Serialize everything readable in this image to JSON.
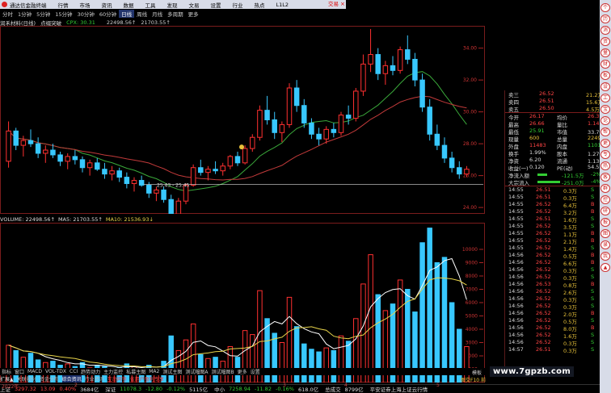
{
  "titlebar": {
    "app_name": "通达信金融终端",
    "menus": [
      "行情",
      "市场",
      "资讯",
      "数据",
      "工具",
      "发现",
      "文易",
      "设置",
      "行业",
      "热点",
      "L1L2"
    ],
    "trade_label": "交易",
    "close_label": "×"
  },
  "periods": [
    "分时",
    "1分钟",
    "5分钟",
    "15分钟",
    "30分钟",
    "60分钟",
    "日线",
    "周线",
    "月线",
    "多周期",
    "更多"
  ],
  "active_period": 6,
  "info": {
    "stock": "润禾材料(日线)",
    "pattern": "点缀突破",
    "cpx": "CPX: 30.31",
    "v1": "22498.56↑",
    "v2": "21703.55↑"
  },
  "price_axis": {
    "ticks": [
      "34.00",
      "32.00",
      "30.00",
      "28.00",
      "26.00",
      "24.00"
    ]
  },
  "annotations": {
    "range": "25.43 - 25.45",
    "low": "22.99"
  },
  "volume": {
    "label": "VOLUME: 22498.56↑",
    "ma5": "MA5: 21703.55↑",
    "ma10": "MA10: 21536.93↓",
    "ticks": [
      "10000",
      "9000",
      "8000",
      "7000",
      "6000",
      "5000",
      "4000",
      "3000",
      "2000",
      "1000"
    ]
  },
  "xaxis": {
    "year": "2022年",
    "months": [
      "2",
      "3",
      "4",
      "5"
    ]
  },
  "quote": {
    "asks": [
      [
        "卖三",
        "26.52",
        "21.2万"
      ],
      [
        "卖四",
        "26.51",
        "15.6万"
      ],
      [
        "卖五",
        "26.50",
        "4.5万"
      ]
    ],
    "stats": [
      [
        "今开",
        "26.17",
        "均价",
        "26.36"
      ],
      [
        "最高",
        "26.66",
        "量比",
        "1.14"
      ],
      [
        "最低",
        "25.91",
        "市值",
        "33.7亿"
      ],
      [
        "现量",
        "600",
        "总量",
        "22499"
      ],
      [
        "外盘",
        "11483",
        "内盘",
        "11016"
      ],
      [
        "换手",
        "1.99%",
        "股本",
        "1.27亿"
      ],
      [
        "净资",
        "6.20",
        "流通",
        "1.13亿"
      ],
      [
        "收益(一)",
        "0.120",
        "PE(动)",
        "54.5"
      ]
    ],
    "flows": [
      [
        "净流入额",
        "-121.5万",
        "-2%"
      ],
      [
        "大宗流入",
        "-251.0万",
        "-4%"
      ]
    ],
    "ticks": [
      [
        "14:55",
        "26.51",
        "0.3万",
        "S"
      ],
      [
        "14:55",
        "26.51",
        "0.3万",
        "S"
      ],
      [
        "14:55",
        "26.52",
        "6.4万",
        "B"
      ],
      [
        "14:55",
        "26.52",
        "3.2万",
        "B"
      ],
      [
        "14:55",
        "26.51",
        "1.6万",
        "S"
      ],
      [
        "14:55",
        "26.52",
        "3.5万",
        "S"
      ],
      [
        "14:55",
        "26.52",
        "1.1万",
        "B"
      ],
      [
        "14:55",
        "26.52",
        "2.1万",
        "B"
      ],
      [
        "14:55",
        "26.52",
        "1.4万",
        "S"
      ],
      [
        "14:56",
        "26.52",
        "0.5万",
        "B"
      ],
      [
        "14:56",
        "26.52",
        "6.6万",
        "B"
      ],
      [
        "14:56",
        "26.52",
        "0.3万",
        "S"
      ],
      [
        "14:56",
        "26.52",
        "0.3万",
        "S"
      ],
      [
        "14:56",
        "26.53",
        "0.8万",
        "B"
      ],
      [
        "14:56",
        "26.52",
        "2.6万",
        "S"
      ],
      [
        "14:56",
        "26.52",
        "0.3万",
        "S"
      ],
      [
        "14:56",
        "26.52",
        "0.3万",
        "S"
      ],
      [
        "14:56",
        "26.52",
        "2.0万",
        "B"
      ],
      [
        "14:56",
        "26.52",
        "0.5万",
        "S"
      ],
      [
        "14:56",
        "26.52",
        "8.0万",
        "B"
      ],
      [
        "14:56",
        "26.52",
        "1.6万",
        "S"
      ],
      [
        "14:56",
        "26.52",
        "0.3万",
        "S"
      ],
      [
        "14:57",
        "26.51",
        "0.3万",
        "S"
      ]
    ]
  },
  "tabs": [
    "指标",
    "窗口",
    "MACD",
    "VOL-TDX",
    "CCI",
    "趋势动力",
    "主力监控",
    "私募主图",
    "MA2",
    "测试主图",
    "测试幅图A",
    "测试幅图B",
    "更多",
    "设置"
  ],
  "sub_tabs": [
    "扩展▲",
    "关联股份",
    "资金分布",
    "综合资讯",
    "行业资讯",
    "互动问答",
    "雀用户盈利专享"
  ],
  "side_labels": {
    "mode": "模板",
    "right": "图交F10 前"
  },
  "statusbar": {
    "items": [
      [
        "上证",
        "3297.32",
        "13.09",
        "0.40%",
        "3684亿"
      ],
      [
        "深证",
        "11078.3",
        "-12.80",
        "-0.12%",
        "5115亿"
      ],
      [
        "中小",
        "7258.94",
        "-11.82",
        "-0.16%",
        "618.0亿"
      ],
      [
        "总成交",
        "8799亿",
        "",
        " ",
        ""
      ]
    ],
    "ticker": "平安证券上海上证云行情"
  },
  "watermark": "www.7gpzb.com",
  "scroll_icons": [
    "个",
    "历",
    "消",
    "资",
    "量",
    "财",
    "板",
    "设",
    "工",
    "宝",
    "论",
    "帮",
    "更",
    "专",
    "热",
    "客",
    "群",
    "控",
    "研",
    "报",
    "图",
    "录",
    "我",
    "▲"
  ],
  "chart_data": [
    {
      "type": "candlestick",
      "y_axis_ticks": [
        34,
        32,
        30,
        28,
        26,
        24
      ],
      "ylim": [
        23.6,
        35.4
      ],
      "ohlc": [
        [
          26.9,
          29.4,
          26.5,
          28.8
        ],
        [
          28.8,
          29.0,
          27.6,
          27.9
        ],
        [
          27.9,
          28.5,
          27.2,
          28.2
        ],
        [
          28.2,
          28.9,
          27.8,
          28.0
        ],
        [
          28.0,
          28.4,
          27.1,
          27.4
        ],
        [
          27.4,
          27.9,
          26.8,
          27.6
        ],
        [
          27.6,
          28.0,
          27.1,
          27.3
        ],
        [
          27.3,
          27.5,
          26.6,
          26.9
        ],
        [
          26.9,
          27.4,
          26.4,
          27.2
        ],
        [
          27.2,
          27.6,
          26.7,
          27.0
        ],
        [
          27.0,
          27.2,
          26.2,
          26.5
        ],
        [
          26.5,
          27.0,
          26.0,
          26.8
        ],
        [
          26.8,
          27.1,
          26.3,
          26.4
        ],
        [
          26.4,
          26.8,
          25.8,
          26.1
        ],
        [
          26.1,
          26.6,
          25.7,
          26.3
        ],
        [
          26.3,
          26.5,
          25.6,
          25.9
        ],
        [
          25.9,
          26.2,
          25.2,
          25.5
        ],
        [
          25.5,
          25.9,
          25.0,
          25.7
        ],
        [
          25.7,
          26.0,
          25.3,
          25.4
        ],
        [
          25.4,
          25.6,
          24.6,
          24.9
        ],
        [
          24.9,
          25.3,
          24.4,
          25.1
        ],
        [
          25.1,
          25.3,
          24.3,
          24.5
        ],
        [
          24.5,
          24.8,
          23.0,
          23.6
        ],
        [
          23.6,
          24.6,
          23.4,
          24.4
        ],
        [
          24.4,
          25.5,
          24.2,
          25.4
        ],
        [
          25.4,
          26.7,
          25.3,
          26.5
        ],
        [
          26.5,
          27.0,
          26.0,
          26.2
        ],
        [
          26.2,
          26.6,
          25.7,
          26.4
        ],
        [
          26.4,
          26.9,
          26.1,
          26.3
        ],
        [
          26.3,
          26.8,
          26.0,
          26.6
        ],
        [
          26.6,
          27.3,
          26.4,
          27.2
        ],
        [
          27.2,
          27.5,
          26.6,
          26.8
        ],
        [
          26.8,
          27.9,
          26.7,
          27.7
        ],
        [
          27.7,
          28.6,
          27.5,
          28.4
        ],
        [
          28.4,
          30.4,
          28.2,
          30.1
        ],
        [
          30.1,
          31.0,
          29.2,
          29.5
        ],
        [
          29.5,
          30.0,
          28.3,
          28.7
        ],
        [
          28.7,
          29.4,
          28.1,
          29.2
        ],
        [
          29.2,
          31.8,
          29.0,
          31.5
        ],
        [
          31.5,
          32.0,
          30.0,
          30.4
        ],
        [
          30.4,
          30.8,
          29.0,
          29.3
        ],
        [
          29.3,
          29.6,
          28.3,
          28.6
        ],
        [
          28.6,
          29.0,
          27.9,
          28.3
        ],
        [
          28.3,
          29.1,
          28.0,
          28.9
        ],
        [
          28.9,
          29.3,
          28.4,
          28.7
        ],
        [
          28.7,
          30.0,
          28.5,
          29.8
        ],
        [
          29.8,
          30.4,
          29.2,
          29.6
        ],
        [
          29.6,
          31.5,
          29.4,
          31.3
        ],
        [
          31.3,
          33.6,
          31.0,
          33.0
        ],
        [
          33.0,
          35.2,
          32.5,
          33.6
        ],
        [
          33.6,
          34.0,
          32.0,
          32.4
        ],
        [
          32.4,
          33.2,
          31.7,
          32.9
        ],
        [
          32.9,
          33.5,
          32.3,
          32.6
        ],
        [
          32.6,
          34.1,
          32.4,
          33.9
        ],
        [
          33.9,
          34.8,
          33.0,
          33.3
        ],
        [
          33.3,
          33.7,
          31.6,
          32.0
        ],
        [
          32.0,
          32.4,
          30.0,
          30.3
        ],
        [
          30.3,
          30.8,
          28.2,
          28.6
        ],
        [
          28.6,
          29.2,
          27.6,
          27.9
        ],
        [
          27.9,
          28.4,
          26.8,
          27.1
        ],
        [
          27.1,
          27.5,
          26.2,
          26.5
        ],
        [
          26.5,
          26.9,
          25.8,
          26.1
        ],
        [
          26.1,
          26.6,
          25.9,
          26.4
        ]
      ]
    },
    {
      "type": "bar",
      "y_axis_ticks": [
        10000,
        9000,
        8000,
        7000,
        6000,
        5000,
        4000,
        3000,
        2000,
        1000
      ],
      "ylim": [
        0,
        12000
      ],
      "values": [
        2800,
        2400,
        1900,
        2200,
        1700,
        1500,
        1600,
        1300,
        1400,
        1200,
        1500,
        1100,
        1300,
        1200,
        1000,
        1100,
        1400,
        1200,
        900,
        1300,
        1000,
        1600,
        3500,
        2400,
        3200,
        4400,
        2100,
        1800,
        1900,
        1600,
        2700,
        1900,
        3900,
        3600,
        6900,
        4800,
        3700,
        3000,
        6400,
        4200,
        2900,
        2500,
        2300,
        2600,
        2400,
        3500,
        3100,
        4800,
        7400,
        9600,
        6600,
        5400,
        5900,
        7700,
        7000,
        5300,
        10500,
        11600,
        9000,
        9400,
        6000,
        4000,
        2700
      ]
    }
  ]
}
